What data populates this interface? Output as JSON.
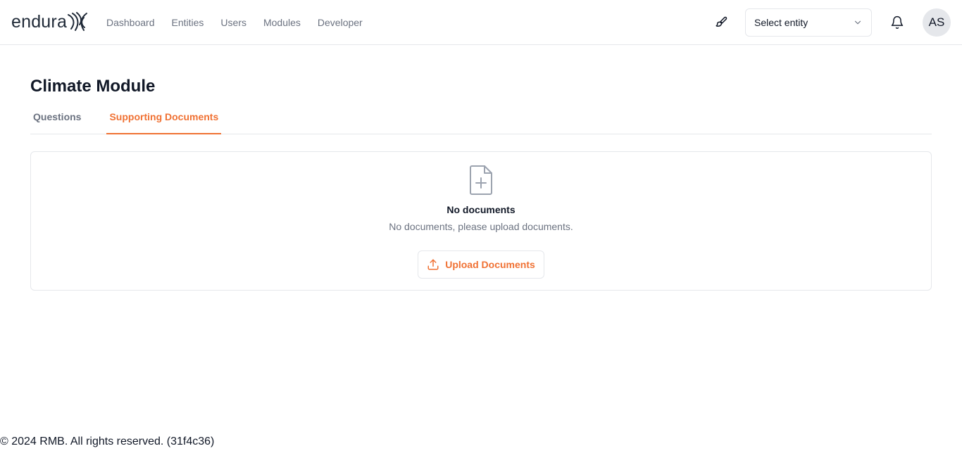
{
  "brand": {
    "logo_text": "endura",
    "accent_color": "#f07133"
  },
  "nav": {
    "items": [
      {
        "label": "Dashboard"
      },
      {
        "label": "Entities"
      },
      {
        "label": "Users"
      },
      {
        "label": "Modules"
      },
      {
        "label": "Developer"
      }
    ]
  },
  "header": {
    "theme_icon": "paintbrush-icon",
    "entity_select": {
      "value": "Select entity",
      "icon": "chevron-down-icon"
    },
    "notifications_icon": "bell-icon",
    "avatar_initials": "AS"
  },
  "page": {
    "title": "Climate Module",
    "tabs": [
      {
        "label": "Questions",
        "active": false
      },
      {
        "label": "Supporting Documents",
        "active": true
      }
    ]
  },
  "empty_state": {
    "icon": "file-plus-icon",
    "title": "No documents",
    "description": "No documents, please upload documents.",
    "button": {
      "label": "Upload Documents",
      "icon": "upload-icon"
    }
  },
  "footer": {
    "text": "© 2024 RMB. All rights reserved. (31f4c36)"
  }
}
